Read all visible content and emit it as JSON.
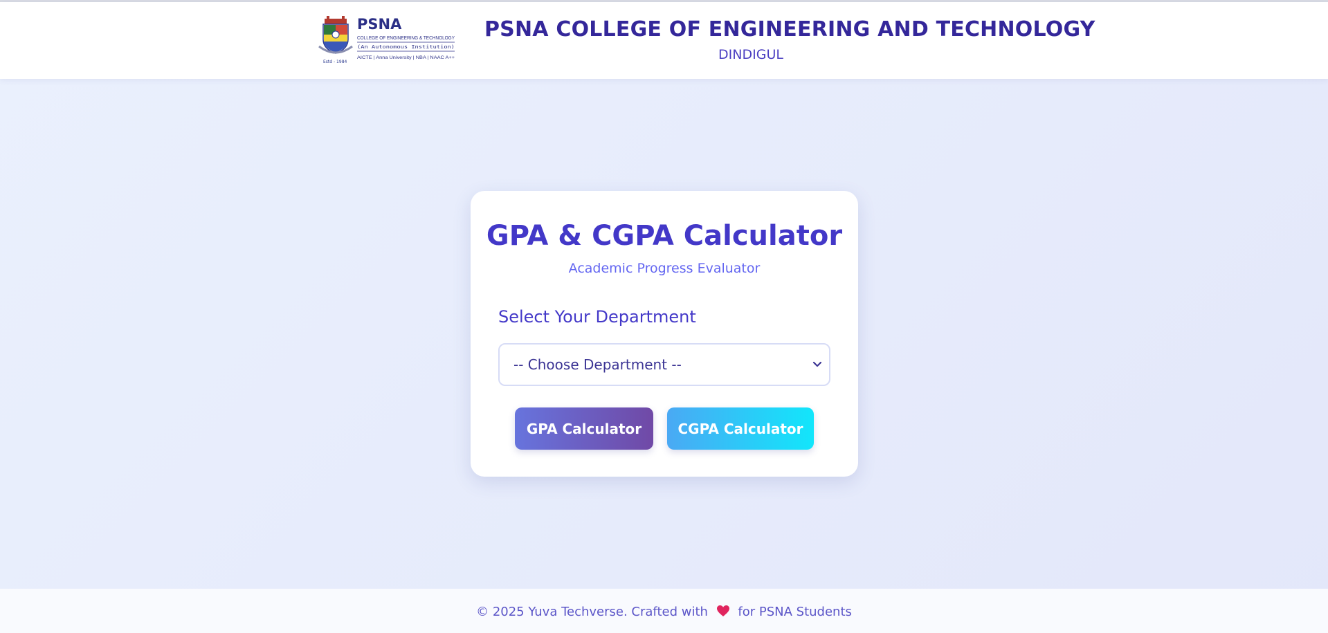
{
  "header": {
    "logo": {
      "name": "PSNA",
      "line1": "COLLEGE OF ENGINEERING & TECHNOLOGY",
      "line2": "(An Autonomous Institution)",
      "line3": "AICTE | Anna University | NBA | NAAC A++",
      "estd": "Estd - 1984",
      "icon": "college-crest-icon"
    },
    "college_name": "PSNA COLLEGE OF ENGINEERING AND TECHNOLOGY",
    "city": "DINDIGUL"
  },
  "card": {
    "title": "GPA & CGPA Calculator",
    "subtitle": "Academic Progress Evaluator",
    "department_label": "Select Your Department",
    "department_select": {
      "selected": "-- Choose Department --",
      "icon": "chevron-down-icon"
    },
    "buttons": {
      "gpa": "GPA Calculator",
      "cgpa": "CGPA Calculator"
    }
  },
  "footer": {
    "prefix": "© 2025 Yuva Techverse. Crafted with",
    "heart_icon": "heart-icon",
    "suffix": "for PSNA Students"
  },
  "colors": {
    "primary": "#4338c8",
    "header_text": "#34279a",
    "gpa_gradient": [
      "#6774dd",
      "#7049a6"
    ],
    "cgpa_gradient": [
      "#4aa9f4",
      "#12e6fb"
    ],
    "heart": "#e0245e"
  }
}
